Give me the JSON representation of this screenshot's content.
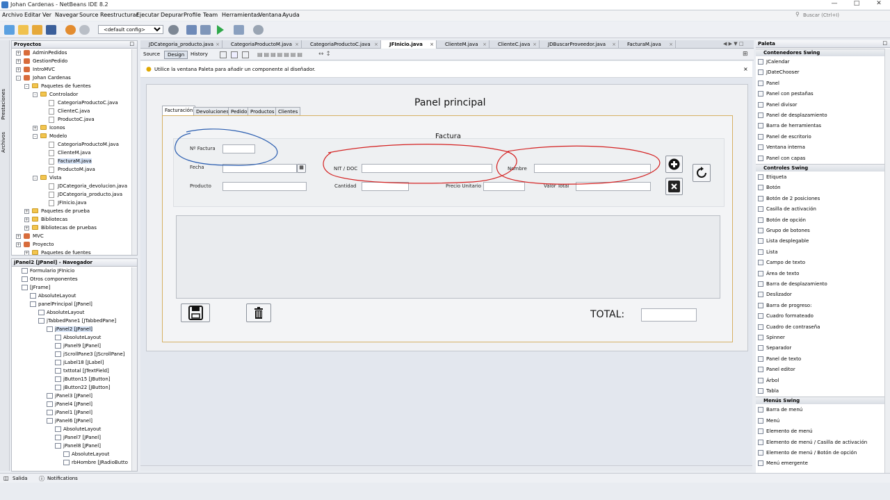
{
  "window": {
    "title": "Johan Cardenas - NetBeans IDE 8.2"
  },
  "menu": [
    "Archivo",
    "Editar",
    "Ver",
    "Navegar",
    "Source",
    "Reestructurar",
    "Ejecutar",
    "Depurar",
    "Profile",
    "Team",
    "Herramientas",
    "Ventana",
    "Ayuda"
  ],
  "search": {
    "placeholder": "Buscar (Ctrl+I)"
  },
  "toolbar": {
    "config": "<default config>"
  },
  "side_tabs": [
    "Prestaciones",
    "Archivos"
  ],
  "projects": {
    "title": "Proyectos",
    "items": [
      "AdminPedidos",
      "GestionPedido",
      "IntroMVC",
      "Johan Cardenas",
      "Paquetes de fuentes",
      "Controlador",
      "CategoriaProductoC.java",
      "ClienteC.java",
      "ProductoC.java",
      "Iconos",
      "Modelo",
      "CategoriaProductoM.java",
      "ClienteM.java",
      "FacturaM.java",
      "ProductoM.java",
      "Vista",
      "JDCategoria_devolucion.java",
      "JDCategoria_producto.java",
      "JFInicio.java",
      "Paquetes de prueba",
      "Bibliotecas",
      "Bibliotecas de pruebas",
      "MVC",
      "Proyecto",
      "Paquetes de fuentes"
    ]
  },
  "navigator": {
    "title": "jPanel2 [JPanel] - Navegador",
    "items": [
      "Formulario JFInicio",
      "Otros componentes",
      "[JFrame]",
      "AbsoluteLayout",
      "panelPrincipal [JPanel]",
      "AbsoluteLayout",
      "jTabbedPane1 [JTabbedPane]",
      "jPanel2 [JPanel]",
      "AbsoluteLayout",
      "jPanel9 [JPanel]",
      "jScrollPane3 [JScrollPane]",
      "jLabel18 [JLabel]",
      "txttotal [JTextField]",
      "jButton15 [JButton]",
      "jButton22 [JButton]",
      "jPanel3 [JPanel]",
      "jPanel4 [JPanel]",
      "jPanel1 [JPanel]",
      "jPanel6 [JPanel]",
      "AbsoluteLayout",
      "jPanel7 [JPanel]",
      "jPanel8 [JPanel]",
      "AbsoluteLayout",
      "rbHombre [JRadioButto"
    ]
  },
  "editor_tabs": [
    "JDCategoria_producto.java",
    "CategoriaProductoM.java",
    "CategoriaProductoC.java",
    "JFInicio.java",
    "ClienteM.java",
    "ClienteC.java",
    "JDBuscarProveedor.java",
    "FacturaM.java"
  ],
  "editor_modes": [
    "Source",
    "Design",
    "History"
  ],
  "hint": "Utilice la ventana Paleta para añadir un componente al diseñador.",
  "form": {
    "title": "Panel principal",
    "tabs": [
      "Facturación",
      "Devoluciones",
      "Pedido",
      "Productos",
      "Clientes"
    ],
    "section_title": "Factura",
    "labels": {
      "nfactura": "Nº Factura",
      "fecha": "Fecha",
      "producto": "Producto",
      "nit": "NIT / DOC",
      "nombre": "Nombre",
      "cantidad": "Cantidad",
      "precio": "Precio Unitario",
      "valor": "Valor Total"
    },
    "total_label": "TOTAL:"
  },
  "palette": {
    "title": "Paleta",
    "cat1": "Contenedores Swing",
    "items1": [
      "JCalendar",
      "JDateChooser",
      "Panel",
      "Panel con pestañas",
      "Panel divisor",
      "Panel de desplazamiento",
      "Barra de herramientas",
      "Panel de escritorio",
      "Ventana interna",
      "Panel con capas"
    ],
    "cat2": "Controles Swing",
    "items2": [
      "Etiqueta",
      "Botón",
      "Botón de 2 posiciones",
      "Casilla de activación",
      "Botón de opción",
      "Grupo de botones",
      "Lista desplegable",
      "Lista",
      "Campo de texto",
      "Área de texto",
      "Barra de desplazamiento",
      "Deslizador",
      "Barra de progreso:",
      "Cuadro formateado",
      "Cuadro de contraseña",
      "Spinner",
      "Separador",
      "Panel de texto",
      "Panel editor",
      "Árbol",
      "Tabla"
    ],
    "cat3": "Menús Swing",
    "items3": [
      "Barra de menú",
      "Menú",
      "Elemento de menú",
      "Elemento de menú / Casilla de activación",
      "Elemento de menú / Botón de opción",
      "Menú emergente"
    ]
  },
  "status": {
    "output": "Salida",
    "notifications": "Notifications"
  }
}
